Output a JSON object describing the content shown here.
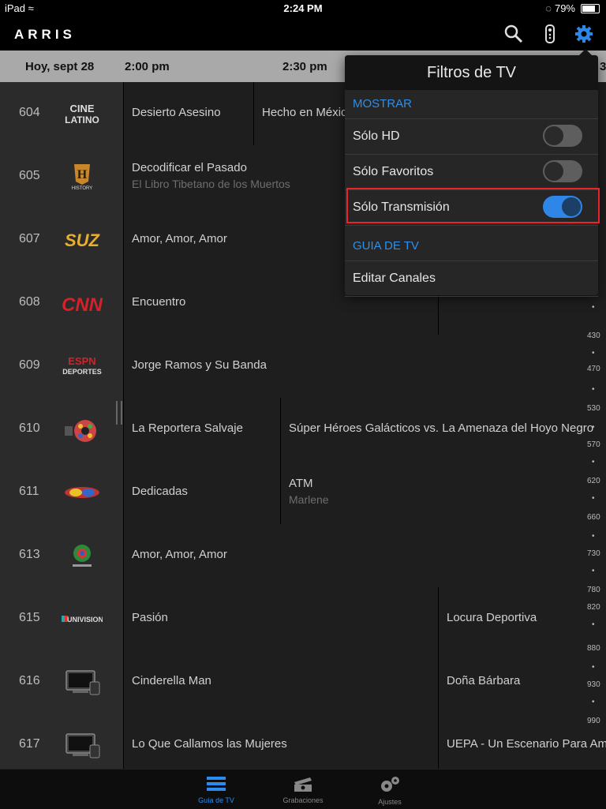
{
  "status": {
    "device": "iPad",
    "time": "2:24 PM",
    "battery": "79%",
    "battery_level": 0.79
  },
  "app": {
    "logo": "ARRIS"
  },
  "nav": {
    "icons": [
      "search-icon",
      "remote-icon",
      "gear-icon"
    ]
  },
  "timebar": {
    "date": "Hoy, sept 28",
    "times": [
      "2:00 pm",
      "2:30 pm",
      "3"
    ]
  },
  "channels": [
    {
      "num": "604",
      "logo": "CINE LATINO",
      "programs": [
        {
          "title": "Desierto Asesino"
        },
        {
          "title": "Hecho en México"
        }
      ]
    },
    {
      "num": "605",
      "logo": "HISTORY",
      "programs": [
        {
          "title": "Decodificar el Pasado",
          "subtitle": "El Libro Tibetano de los Muertos"
        }
      ]
    },
    {
      "num": "607",
      "logo": "SUZ",
      "programs": [
        {
          "title": "Amor, Amor, Amor"
        }
      ]
    },
    {
      "num": "608",
      "logo": "CNN",
      "programs": [
        {
          "title": "Encuentro"
        },
        {
          "title": ""
        }
      ]
    },
    {
      "num": "609",
      "logo": "ESPN DEPORTES",
      "programs": [
        {
          "title": "Jorge Ramos y Su Banda"
        }
      ]
    },
    {
      "num": "610",
      "logo": "",
      "programs": [
        {
          "title": "La Reportera Salvaje"
        },
        {
          "title": "Súper Héroes Galácticos vs. La Amenaza del Hoyo Negro"
        }
      ]
    },
    {
      "num": "611",
      "logo": "",
      "programs": [
        {
          "title": "Dedicadas"
        },
        {
          "title": "ATM",
          "subtitle": "Marlene"
        }
      ]
    },
    {
      "num": "613",
      "logo": "",
      "programs": [
        {
          "title": "Amor, Amor, Amor"
        }
      ]
    },
    {
      "num": "615",
      "logo": "UNIVISION",
      "programs": [
        {
          "title": "Pasión"
        },
        {
          "title": "Locura Deportiva"
        }
      ]
    },
    {
      "num": "616",
      "logo": "",
      "programs": [
        {
          "title": "Cinderella Man"
        },
        {
          "title": "Doña Bárbara"
        }
      ]
    },
    {
      "num": "617",
      "logo": "",
      "programs": [
        {
          "title": "Lo Que Callamos las Mujeres"
        },
        {
          "title": "UEPA - Un Escenario Para Amar"
        }
      ]
    }
  ],
  "ruler": [
    "430",
    "470",
    "530",
    "570",
    "620",
    "660",
    "730",
    "780",
    "820",
    "880",
    "930",
    "990"
  ],
  "popover": {
    "title": "Filtros de TV",
    "section1": "MOSTRAR",
    "items": [
      {
        "label": "Sólo HD",
        "on": false
      },
      {
        "label": "Sólo Favoritos",
        "on": false
      },
      {
        "label": "Sólo Transmisión",
        "on": true
      }
    ],
    "section2": "GUIA DE TV",
    "edit": "Editar Canales"
  },
  "tabs": [
    {
      "label": "Guía de TV",
      "active": true
    },
    {
      "label": "Grabaciones",
      "active": false
    },
    {
      "label": "Ajustes",
      "active": false
    }
  ]
}
